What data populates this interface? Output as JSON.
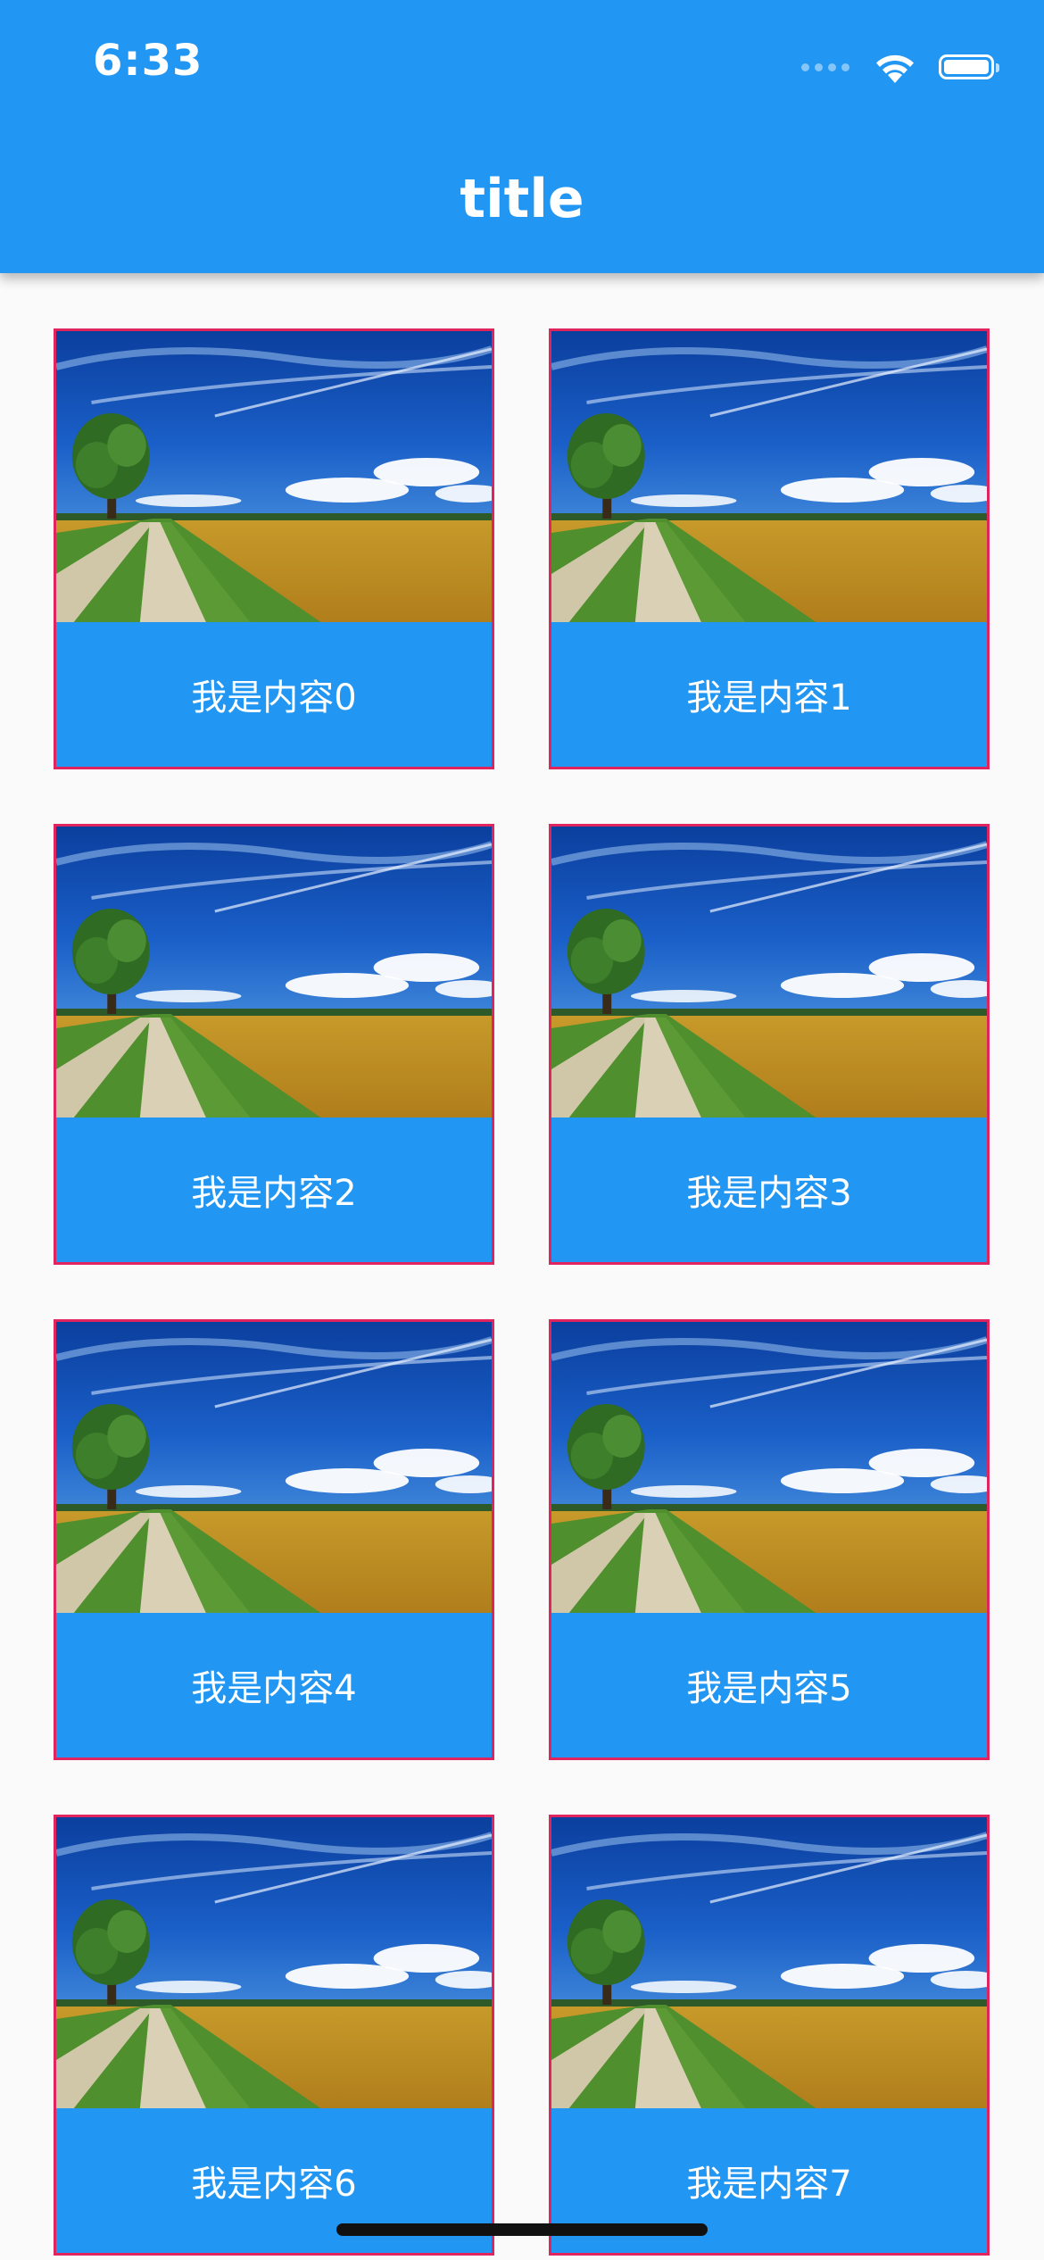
{
  "status_bar": {
    "time": "6:33"
  },
  "app_bar": {
    "title": "title"
  },
  "cards": [
    {
      "label": "我是内容0",
      "image": "landscape-photo"
    },
    {
      "label": "我是内容1",
      "image": "landscape-photo"
    },
    {
      "label": "我是内容2",
      "image": "landscape-photo"
    },
    {
      "label": "我是内容3",
      "image": "landscape-photo"
    },
    {
      "label": "我是内容4",
      "image": "landscape-photo"
    },
    {
      "label": "我是内容5",
      "image": "landscape-photo"
    },
    {
      "label": "我是内容6",
      "image": "landscape-photo"
    },
    {
      "label": "我是内容7",
      "image": "landscape-photo"
    }
  ],
  "colors": {
    "primary": "#2196f3",
    "card_border": "#e0245e",
    "background": "#fafafa"
  }
}
